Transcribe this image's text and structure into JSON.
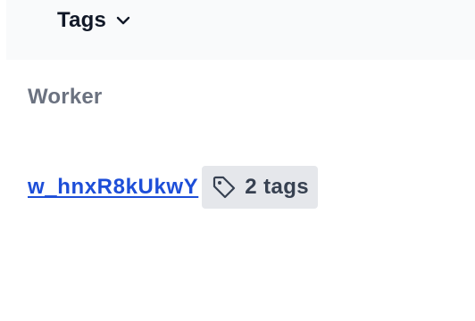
{
  "header": {
    "title": "Tags",
    "toggle_icon": "chevron-down-icon"
  },
  "section": {
    "label": "Worker"
  },
  "worker": {
    "id_link": "w_hnxR8kUkwY",
    "tags_badge": "2 tags",
    "tag_icon": "tag-icon"
  },
  "colors": {
    "link": "#1d4ed8",
    "badge_bg": "#e5e7eb",
    "header_bg": "#f9fafb",
    "label_gray": "#6b7280",
    "text_dark": "#111827"
  }
}
